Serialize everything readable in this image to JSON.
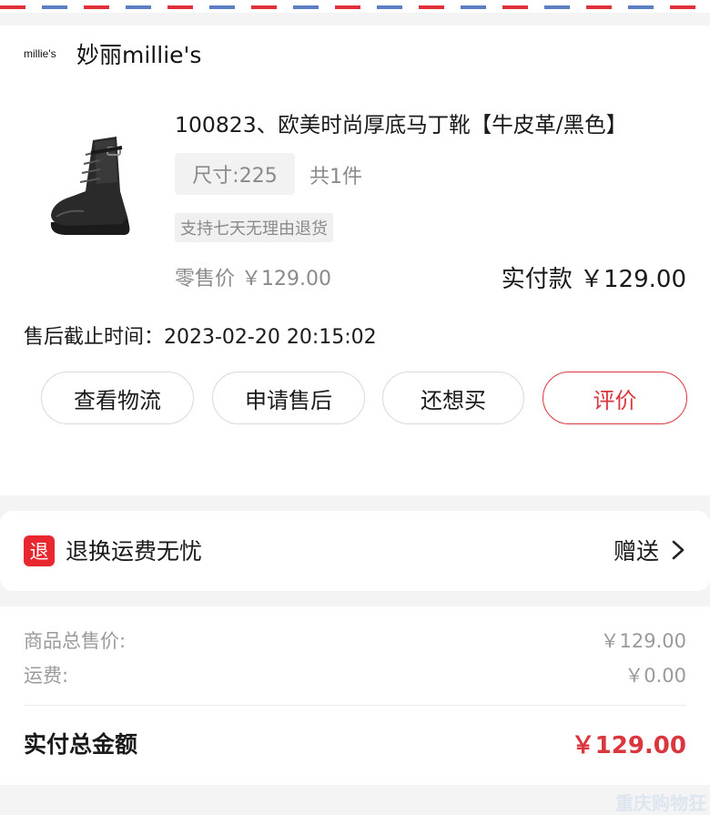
{
  "shop": {
    "logo_text": "millie's",
    "name": "妙丽millie's"
  },
  "product": {
    "title": "100823、欧美时尚厚底马丁靴【牛皮革/黑色】",
    "size": "尺寸:225",
    "quantity": "共1件",
    "return_tag": "支持七天无理由退货",
    "retail_price": "零售价 ￥129.00",
    "paid_amount": "实付款 ￥129.00",
    "image_icon": "black-martin-boot"
  },
  "after_sale": {
    "deadline": "售后截止时间：2023-02-20 20:15:02"
  },
  "actions": {
    "logistics": "查看物流",
    "after_sale": "申请售后",
    "buy_again": "还想买",
    "review": "评价"
  },
  "freight_insurance": {
    "badge": "退",
    "title": "退换运费无忧",
    "gift": "赠送"
  },
  "summary": {
    "goods_total_label": "商品总售价:",
    "goods_total_value": "￥129.00",
    "shipping_label": "运费:",
    "shipping_value": "￥0.00",
    "paid_total_label": "实付总金额",
    "paid_total_value": "￥129.00"
  },
  "watermark": "重庆购物狂",
  "colors": {
    "accent_red": "#d9363e",
    "badge_red": "#e8272f",
    "airmail_red": "#e0303a",
    "airmail_blue": "#5b7fc2"
  }
}
